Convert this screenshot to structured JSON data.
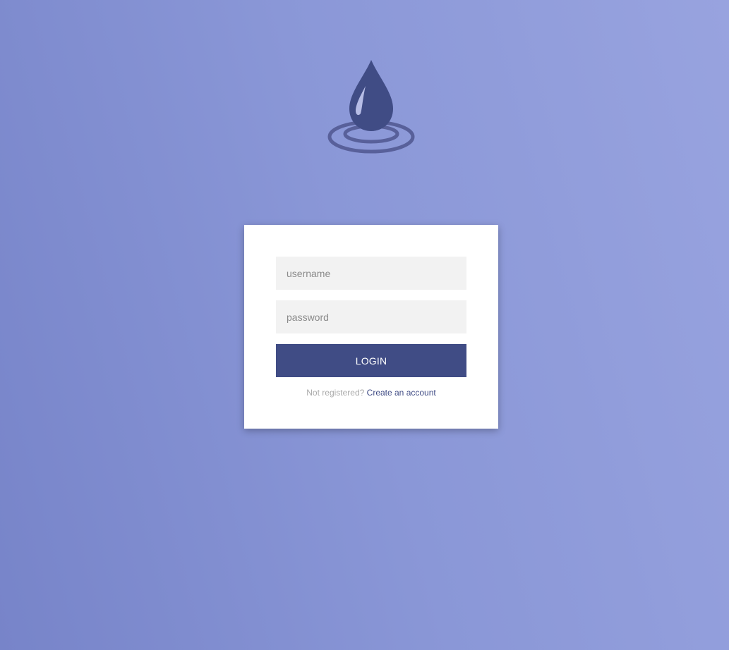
{
  "logo": {
    "icon": "water-drop-icon",
    "color": "#404c85"
  },
  "form": {
    "username_placeholder": "username",
    "username_value": "",
    "password_placeholder": "password",
    "password_value": "",
    "login_label": "LOGIN",
    "not_registered_text": "Not registered?",
    "create_account_label": "Create an account"
  },
  "colors": {
    "background_start": "#7784c9",
    "background_end": "#98a3df",
    "accent": "#404c85",
    "card": "#ffffff",
    "input_bg": "#f2f2f2"
  }
}
